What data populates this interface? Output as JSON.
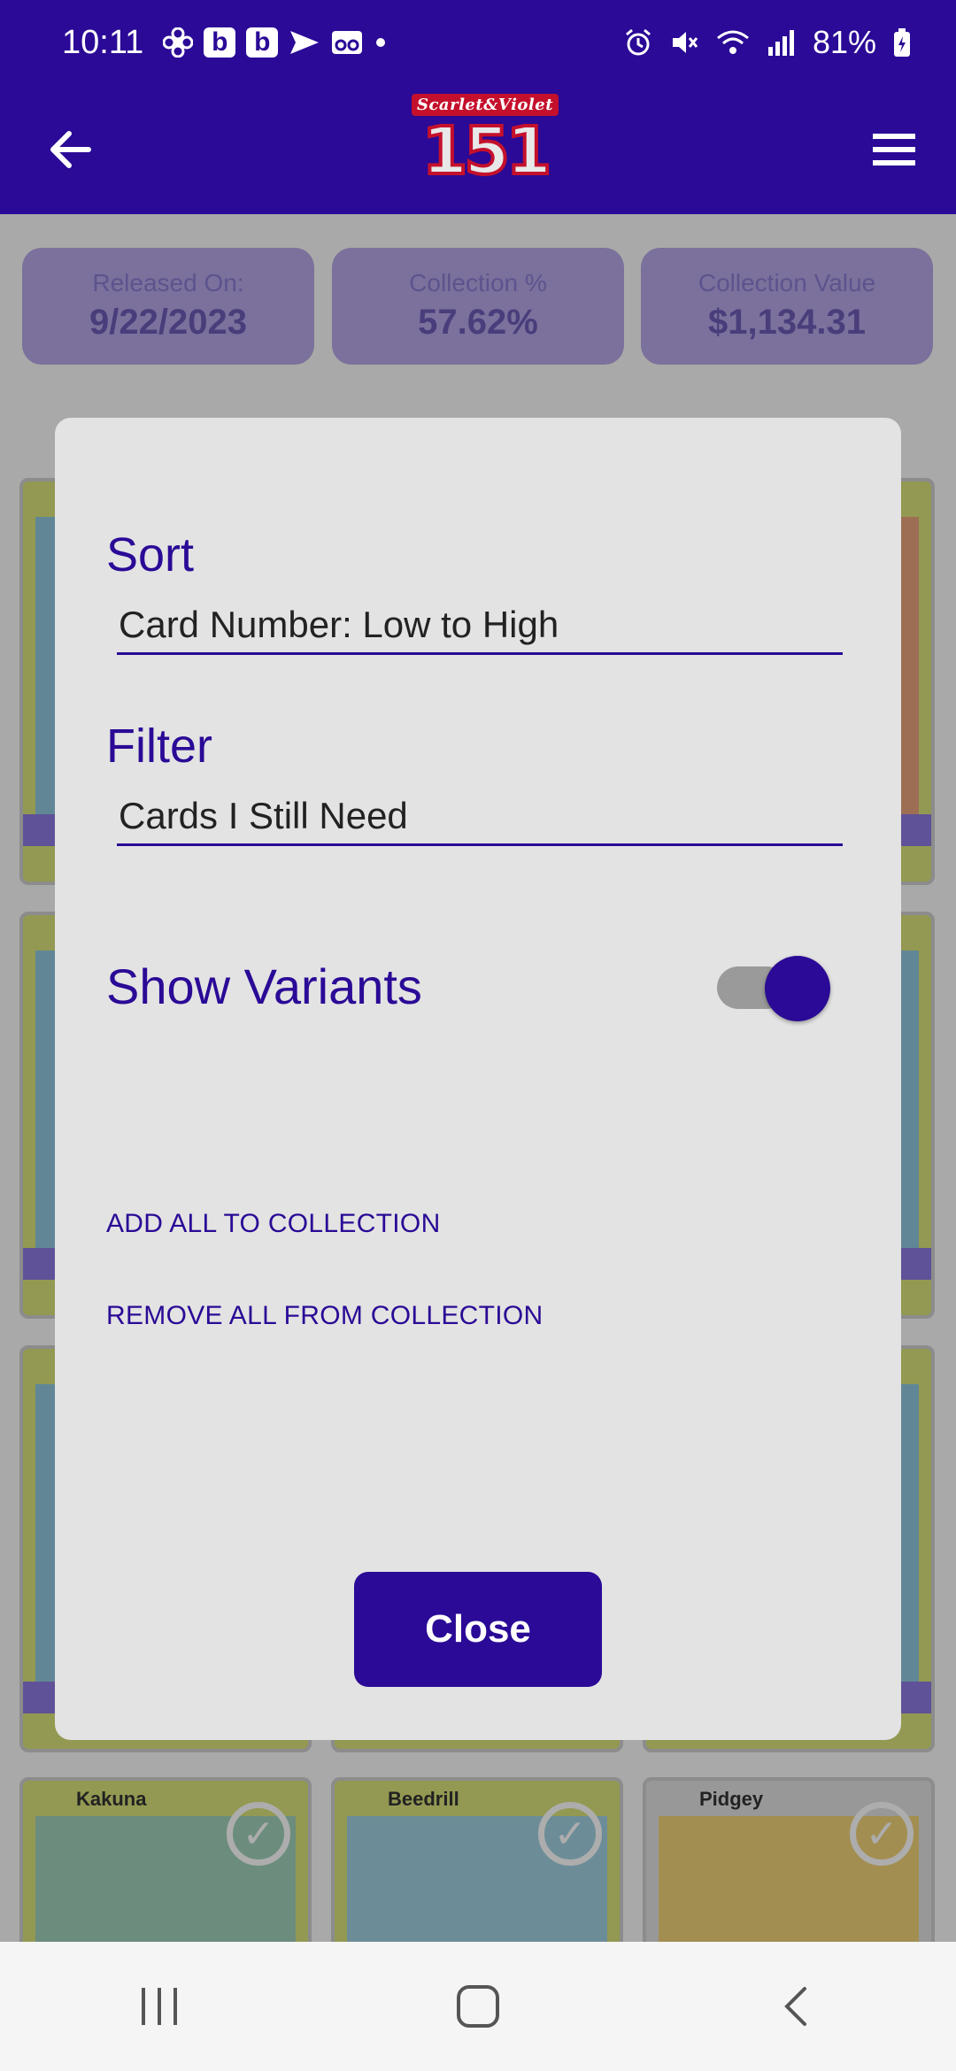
{
  "status_bar": {
    "time": "10:11",
    "notification_icons": [
      "fan-icon",
      "b-icon",
      "b-icon",
      "send-icon",
      "voicemail-icon",
      "dot-icon"
    ],
    "badge_letter": "b",
    "battery": "81%"
  },
  "app_bar": {
    "logo_top": "Scarlet&Violet",
    "logo_number": "151"
  },
  "stats": [
    {
      "label": "Released On:",
      "value": "9/22/2023"
    },
    {
      "label": "Collection %",
      "value": "57.62%"
    },
    {
      "label": "Collection Value",
      "value": "$1,134.31"
    }
  ],
  "cards_row": [
    {
      "name": "Kakuna"
    },
    {
      "name": "Beedrill"
    },
    {
      "name": "Pidgey"
    }
  ],
  "dialog": {
    "sort_title": "Sort",
    "sort_value": "Card Number: Low to High",
    "filter_title": "Filter",
    "filter_value": "Cards I Still Need",
    "variants_label": "Show Variants",
    "variants_on": true,
    "add_all_label": "ADD ALL TO COLLECTION",
    "remove_all_label": "REMOVE ALL FROM COLLECTION",
    "close_label": "Close"
  },
  "colors": {
    "brand": "#2a0a96",
    "dialog_bg": "#e3e3e3"
  }
}
